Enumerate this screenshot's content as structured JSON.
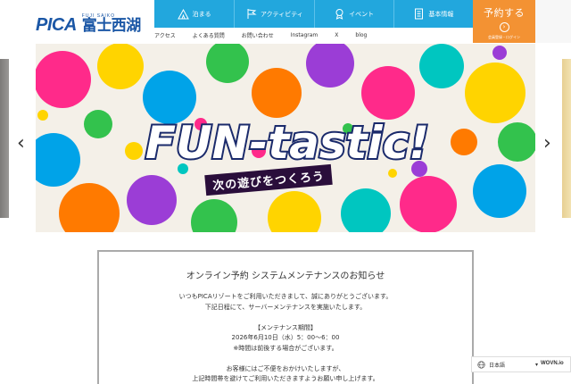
{
  "logo": {
    "brand": "PICA",
    "roman": "FUJI SAIKO",
    "kanji": "富士西湖"
  },
  "mainnav": [
    {
      "label": "泊まる",
      "icon": "tent-icon"
    },
    {
      "label": "アクティビティ",
      "icon": "flag-icon"
    },
    {
      "label": "イベント",
      "icon": "medal-icon"
    },
    {
      "label": "基本情報",
      "icon": "document-icon"
    }
  ],
  "reserve": {
    "label": "予約する",
    "sub": "会員登録・ログイン"
  },
  "subnav": [
    "アクセス",
    "よくある質問",
    "お問い合わせ",
    "Instagram",
    "X",
    "blog"
  ],
  "hero": {
    "title": "FUN-tastic!",
    "subtitle": "次の遊びをつくろう"
  },
  "notice": {
    "title": "オンライン予約 システムメンテナンスのお知らせ",
    "lines": [
      "いつもPICAリゾートをご利用いただきまして、誠にありがとうございます。",
      "下記日程にて、サーバーメンテナンスを実施いたします。",
      "",
      "【メンテナンス期間】",
      "2026年6月10日（水）5：00〜6：00",
      "※時間は前後する場合がございます。",
      "",
      "お客様にはご不便をおかけいたしますが、",
      "上記時間帯を避けてご利用いただきますようお願い申し上げます。"
    ]
  },
  "language": {
    "label": "日本語",
    "brand": "WOVN.io"
  },
  "colors": {
    "nav": "#22a7dd",
    "reserve": "#f39233",
    "brand": "#1b57a6"
  }
}
